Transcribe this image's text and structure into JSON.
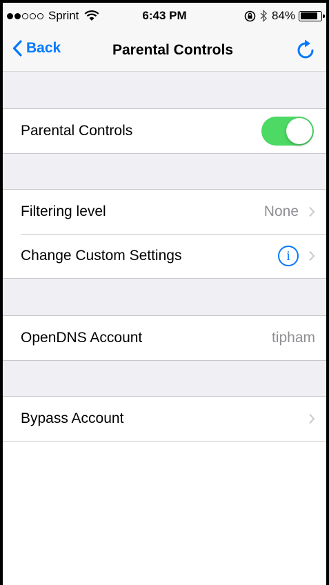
{
  "status_bar": {
    "carrier": "Sprint",
    "time": "6:43 PM",
    "battery": "84%",
    "battery_level": 0.84,
    "signal_bars_filled": 2,
    "signal_bars_total": 5
  },
  "nav": {
    "back_label": "Back",
    "title": "Parental Controls",
    "refresh_icon": "refresh-icon"
  },
  "rows": {
    "parental_controls": {
      "label": "Parental Controls",
      "toggle_on": true
    },
    "filtering_level": {
      "label": "Filtering level",
      "value": "None"
    },
    "custom_settings": {
      "label": "Change Custom Settings",
      "info_glyph": "i"
    },
    "opendns_account": {
      "label": "OpenDNS Account",
      "value": "tipham"
    },
    "bypass_account": {
      "label": "Bypass Account"
    }
  },
  "colors": {
    "accent": "#0079ff",
    "toggle_on": "#4cd964",
    "background": "#efeff4",
    "secondary_text": "#8e8e93"
  }
}
